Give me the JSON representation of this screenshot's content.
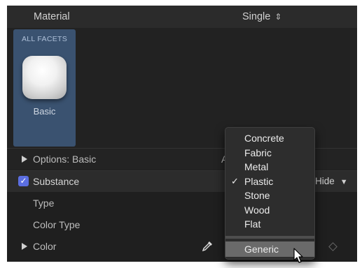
{
  "header": {
    "title": "Material",
    "mode_value": "Single",
    "mode_icon": "up-down-chevron-icon"
  },
  "facets": {
    "tag": "ALL FACETS",
    "tile_label": "Basic"
  },
  "rows": {
    "options_label": "Options: Basic",
    "options_trailing": "A",
    "substance_label": "Substance",
    "substance_checked": true,
    "hide_label": "Hide",
    "type_label": "Type",
    "color_type_label": "Color Type",
    "color_label": "Color"
  },
  "menu": {
    "items": [
      {
        "label": "Concrete",
        "checked": false
      },
      {
        "label": "Fabric",
        "checked": false
      },
      {
        "label": "Metal",
        "checked": false
      },
      {
        "label": "Plastic",
        "checked": true
      },
      {
        "label": "Stone",
        "checked": false
      },
      {
        "label": "Wood",
        "checked": false
      },
      {
        "label": "Flat",
        "checked": false
      }
    ],
    "check_mark": "✓",
    "highlighted": {
      "label": "Generic"
    }
  },
  "colors": {
    "panel_bg": "#1f1f1f",
    "tile_bg": "#3a5270",
    "checkbox_accent": "#5b6ee0",
    "menu_highlight": "#6a6a6a"
  }
}
